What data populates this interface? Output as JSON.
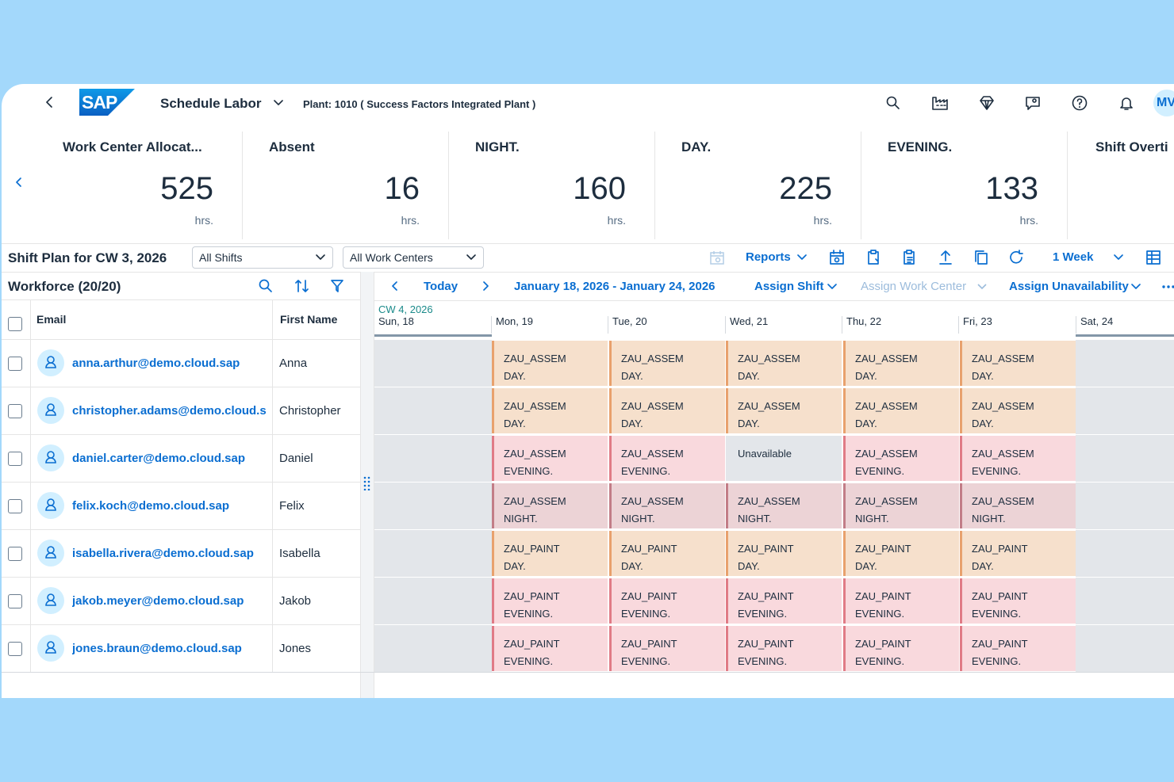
{
  "header": {
    "title": "Schedule Labor",
    "plant": "Plant: 1010 ( Success Factors Integrated Plant )",
    "logo": "SAP",
    "avatar": "MV"
  },
  "kpis": [
    {
      "title": "Work Center Allocat...",
      "value": "525",
      "unit": "hrs."
    },
    {
      "title": "Absent",
      "value": "16",
      "unit": "hrs."
    },
    {
      "title": "NIGHT.",
      "value": "160",
      "unit": "hrs."
    },
    {
      "title": "DAY.",
      "value": "225",
      "unit": "hrs."
    },
    {
      "title": "EVENING.",
      "value": "133",
      "unit": "hrs."
    },
    {
      "title": "Shift Overti",
      "value": "",
      "unit": ""
    }
  ],
  "toolbar": {
    "title": "Shift Plan for CW 3, 2026",
    "shifts_select": "All Shifts",
    "workcenters_select": "All Work Centers",
    "reports": "Reports",
    "range": "1 Week"
  },
  "workforce": {
    "title": "Workforce (20/20)",
    "col_email": "Email",
    "col_first": "First Name"
  },
  "calendar": {
    "today": "Today",
    "range": "January 18, 2026 - January 24, 2026",
    "assign_shift": "Assign Shift",
    "assign_wc": "Assign Work Center",
    "assign_unavail": "Assign Unavailability",
    "cw": "CW 4, 2026",
    "days": [
      "Sun, 18",
      "Mon, 19",
      "Tue, 20",
      "Wed, 21",
      "Thu, 22",
      "Fri, 23",
      "Sat, 24"
    ]
  },
  "rows": [
    {
      "email": "anna.arthur@demo.cloud.sap",
      "first": "Anna",
      "cells": [
        [
          "ZAU_ASSEM",
          "DAY."
        ],
        [
          "ZAU_ASSEM",
          "DAY."
        ],
        [
          "ZAU_ASSEM",
          "DAY."
        ],
        [
          "ZAU_ASSEM",
          "DAY."
        ],
        [
          "ZAU_ASSEM",
          "DAY."
        ]
      ],
      "kinds": [
        "day",
        "day",
        "day",
        "day",
        "day"
      ]
    },
    {
      "email": "christopher.adams@demo.cloud.s",
      "first": "Christopher",
      "cells": [
        [
          "ZAU_ASSEM",
          "DAY."
        ],
        [
          "ZAU_ASSEM",
          "DAY."
        ],
        [
          "ZAU_ASSEM",
          "DAY."
        ],
        [
          "ZAU_ASSEM",
          "DAY."
        ],
        [
          "ZAU_ASSEM",
          "DAY."
        ]
      ],
      "kinds": [
        "day",
        "day",
        "day",
        "day",
        "day"
      ]
    },
    {
      "email": "daniel.carter@demo.cloud.sap",
      "first": "Daniel",
      "cells": [
        [
          "ZAU_ASSEM",
          "EVENING."
        ],
        [
          "ZAU_ASSEM",
          "EVENING."
        ],
        [
          "Unavailable",
          ""
        ],
        [
          "ZAU_ASSEM",
          "EVENING."
        ],
        [
          "ZAU_ASSEM",
          "EVENING."
        ]
      ],
      "kinds": [
        "evening",
        "evening",
        "unavail",
        "evening",
        "evening"
      ]
    },
    {
      "email": "felix.koch@demo.cloud.sap",
      "first": "Felix",
      "cells": [
        [
          "ZAU_ASSEM",
          "NIGHT."
        ],
        [
          "ZAU_ASSEM",
          "NIGHT."
        ],
        [
          "ZAU_ASSEM",
          "NIGHT."
        ],
        [
          "ZAU_ASSEM",
          "NIGHT."
        ],
        [
          "ZAU_ASSEM",
          "NIGHT."
        ]
      ],
      "kinds": [
        "night",
        "night",
        "night",
        "night",
        "night"
      ]
    },
    {
      "email": "isabella.rivera@demo.cloud.sap",
      "first": "Isabella",
      "cells": [
        [
          "ZAU_PAINT",
          "DAY."
        ],
        [
          "ZAU_PAINT",
          "DAY."
        ],
        [
          "ZAU_PAINT",
          "DAY."
        ],
        [
          "ZAU_PAINT",
          "DAY."
        ],
        [
          "ZAU_PAINT",
          "DAY."
        ]
      ],
      "kinds": [
        "day",
        "day",
        "day",
        "day",
        "day"
      ]
    },
    {
      "email": "jakob.meyer@demo.cloud.sap",
      "first": "Jakob",
      "cells": [
        [
          "ZAU_PAINT",
          "EVENING."
        ],
        [
          "ZAU_PAINT",
          "EVENING."
        ],
        [
          "ZAU_PAINT",
          "EVENING."
        ],
        [
          "ZAU_PAINT",
          "EVENING."
        ],
        [
          "ZAU_PAINT",
          "EVENING."
        ]
      ],
      "kinds": [
        "evening",
        "evening",
        "evening",
        "evening",
        "evening"
      ]
    },
    {
      "email": "jones.braun@demo.cloud.sap",
      "first": "Jones",
      "cells": [
        [
          "ZAU_PAINT",
          "EVENING."
        ],
        [
          "ZAU_PAINT",
          "EVENING."
        ],
        [
          "ZAU_PAINT",
          "EVENING."
        ],
        [
          "ZAU_PAINT",
          "EVENING."
        ],
        [
          "ZAU_PAINT",
          "EVENING."
        ]
      ],
      "kinds": [
        "evening",
        "evening",
        "evening",
        "evening",
        "evening"
      ]
    }
  ]
}
